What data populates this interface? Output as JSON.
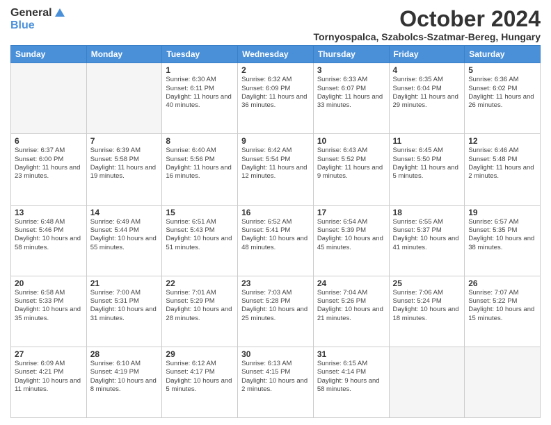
{
  "logo": {
    "general": "General",
    "blue": "Blue"
  },
  "title": {
    "month": "October 2024",
    "location": "Tornyospalca, Szabolcs-Szatmar-Bereg, Hungary"
  },
  "weekdays": [
    "Sunday",
    "Monday",
    "Tuesday",
    "Wednesday",
    "Thursday",
    "Friday",
    "Saturday"
  ],
  "weeks": [
    [
      {
        "day": "",
        "content": ""
      },
      {
        "day": "",
        "content": ""
      },
      {
        "day": "1",
        "content": "Sunrise: 6:30 AM\nSunset: 6:11 PM\nDaylight: 11 hours and 40 minutes."
      },
      {
        "day": "2",
        "content": "Sunrise: 6:32 AM\nSunset: 6:09 PM\nDaylight: 11 hours and 36 minutes."
      },
      {
        "day": "3",
        "content": "Sunrise: 6:33 AM\nSunset: 6:07 PM\nDaylight: 11 hours and 33 minutes."
      },
      {
        "day": "4",
        "content": "Sunrise: 6:35 AM\nSunset: 6:04 PM\nDaylight: 11 hours and 29 minutes."
      },
      {
        "day": "5",
        "content": "Sunrise: 6:36 AM\nSunset: 6:02 PM\nDaylight: 11 hours and 26 minutes."
      }
    ],
    [
      {
        "day": "6",
        "content": "Sunrise: 6:37 AM\nSunset: 6:00 PM\nDaylight: 11 hours and 23 minutes."
      },
      {
        "day": "7",
        "content": "Sunrise: 6:39 AM\nSunset: 5:58 PM\nDaylight: 11 hours and 19 minutes."
      },
      {
        "day": "8",
        "content": "Sunrise: 6:40 AM\nSunset: 5:56 PM\nDaylight: 11 hours and 16 minutes."
      },
      {
        "day": "9",
        "content": "Sunrise: 6:42 AM\nSunset: 5:54 PM\nDaylight: 11 hours and 12 minutes."
      },
      {
        "day": "10",
        "content": "Sunrise: 6:43 AM\nSunset: 5:52 PM\nDaylight: 11 hours and 9 minutes."
      },
      {
        "day": "11",
        "content": "Sunrise: 6:45 AM\nSunset: 5:50 PM\nDaylight: 11 hours and 5 minutes."
      },
      {
        "day": "12",
        "content": "Sunrise: 6:46 AM\nSunset: 5:48 PM\nDaylight: 11 hours and 2 minutes."
      }
    ],
    [
      {
        "day": "13",
        "content": "Sunrise: 6:48 AM\nSunset: 5:46 PM\nDaylight: 10 hours and 58 minutes."
      },
      {
        "day": "14",
        "content": "Sunrise: 6:49 AM\nSunset: 5:44 PM\nDaylight: 10 hours and 55 minutes."
      },
      {
        "day": "15",
        "content": "Sunrise: 6:51 AM\nSunset: 5:43 PM\nDaylight: 10 hours and 51 minutes."
      },
      {
        "day": "16",
        "content": "Sunrise: 6:52 AM\nSunset: 5:41 PM\nDaylight: 10 hours and 48 minutes."
      },
      {
        "day": "17",
        "content": "Sunrise: 6:54 AM\nSunset: 5:39 PM\nDaylight: 10 hours and 45 minutes."
      },
      {
        "day": "18",
        "content": "Sunrise: 6:55 AM\nSunset: 5:37 PM\nDaylight: 10 hours and 41 minutes."
      },
      {
        "day": "19",
        "content": "Sunrise: 6:57 AM\nSunset: 5:35 PM\nDaylight: 10 hours and 38 minutes."
      }
    ],
    [
      {
        "day": "20",
        "content": "Sunrise: 6:58 AM\nSunset: 5:33 PM\nDaylight: 10 hours and 35 minutes."
      },
      {
        "day": "21",
        "content": "Sunrise: 7:00 AM\nSunset: 5:31 PM\nDaylight: 10 hours and 31 minutes."
      },
      {
        "day": "22",
        "content": "Sunrise: 7:01 AM\nSunset: 5:29 PM\nDaylight: 10 hours and 28 minutes."
      },
      {
        "day": "23",
        "content": "Sunrise: 7:03 AM\nSunset: 5:28 PM\nDaylight: 10 hours and 25 minutes."
      },
      {
        "day": "24",
        "content": "Sunrise: 7:04 AM\nSunset: 5:26 PM\nDaylight: 10 hours and 21 minutes."
      },
      {
        "day": "25",
        "content": "Sunrise: 7:06 AM\nSunset: 5:24 PM\nDaylight: 10 hours and 18 minutes."
      },
      {
        "day": "26",
        "content": "Sunrise: 7:07 AM\nSunset: 5:22 PM\nDaylight: 10 hours and 15 minutes."
      }
    ],
    [
      {
        "day": "27",
        "content": "Sunrise: 6:09 AM\nSunset: 4:21 PM\nDaylight: 10 hours and 11 minutes."
      },
      {
        "day": "28",
        "content": "Sunrise: 6:10 AM\nSunset: 4:19 PM\nDaylight: 10 hours and 8 minutes."
      },
      {
        "day": "29",
        "content": "Sunrise: 6:12 AM\nSunset: 4:17 PM\nDaylight: 10 hours and 5 minutes."
      },
      {
        "day": "30",
        "content": "Sunrise: 6:13 AM\nSunset: 4:15 PM\nDaylight: 10 hours and 2 minutes."
      },
      {
        "day": "31",
        "content": "Sunrise: 6:15 AM\nSunset: 4:14 PM\nDaylight: 9 hours and 58 minutes."
      },
      {
        "day": "",
        "content": ""
      },
      {
        "day": "",
        "content": ""
      }
    ]
  ]
}
